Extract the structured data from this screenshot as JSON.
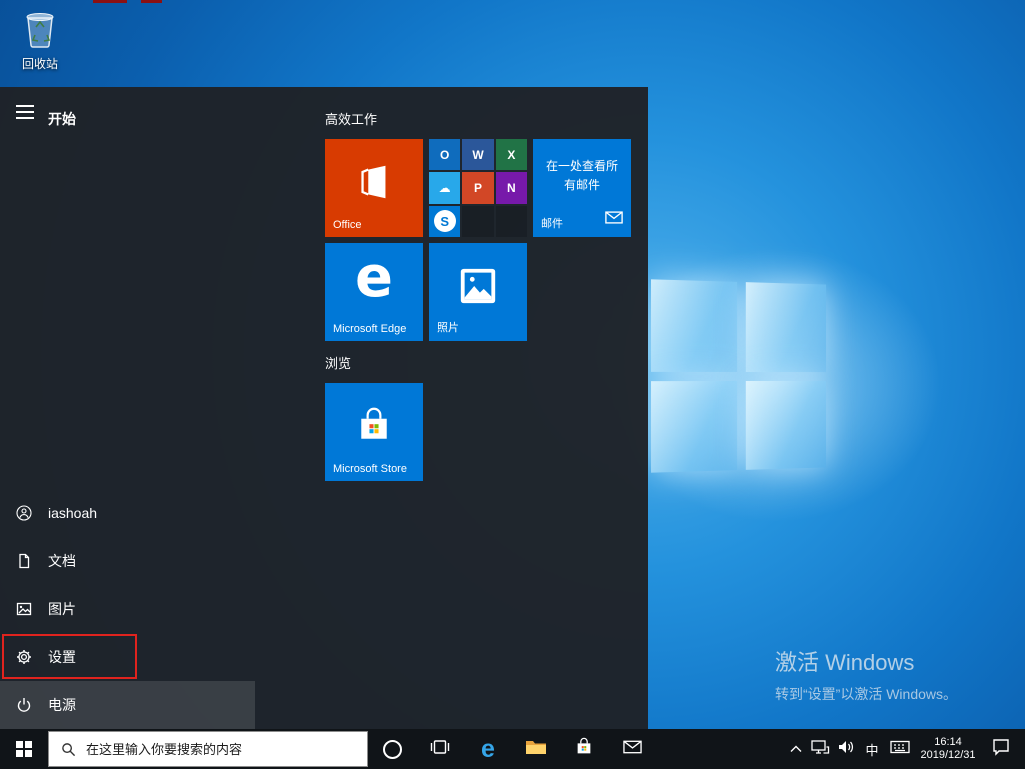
{
  "colors": {
    "accent_blue": "#0078d7",
    "office_orange": "#d83b01",
    "highlight_red": "#e0231e",
    "menu_bg": "#1f2227",
    "taskbar_bg": "#101418"
  },
  "desktop": {
    "recycle_bin_label": "回收站",
    "activation_title": "激活 Windows",
    "activation_subtitle": "转到“设置”以激活 Windows。"
  },
  "start_menu": {
    "header_label": "开始",
    "group1_title": "高效工作",
    "group2_title": "浏览",
    "rail": {
      "user": "iashoah",
      "documents": "文档",
      "pictures": "图片",
      "settings": "设置",
      "power": "电源"
    },
    "tiles": {
      "office_label": "Office",
      "mail_body": "在一处查看所有邮件",
      "mail_label": "邮件",
      "edge_letter": "e",
      "edge_label": "Microsoft Edge",
      "photos_label": "照片",
      "store_label": "Microsoft Store"
    },
    "small_tiles": {
      "outlook": "O",
      "word": "W",
      "excel": "X",
      "onedrive": "☁",
      "powerpoint": "P",
      "onenote": "N",
      "skype": "S"
    }
  },
  "taskbar": {
    "search_placeholder": "在这里输入你要搜索的内容",
    "ime_indicator": "中",
    "time": "16:14",
    "date": "2019/12/31"
  }
}
